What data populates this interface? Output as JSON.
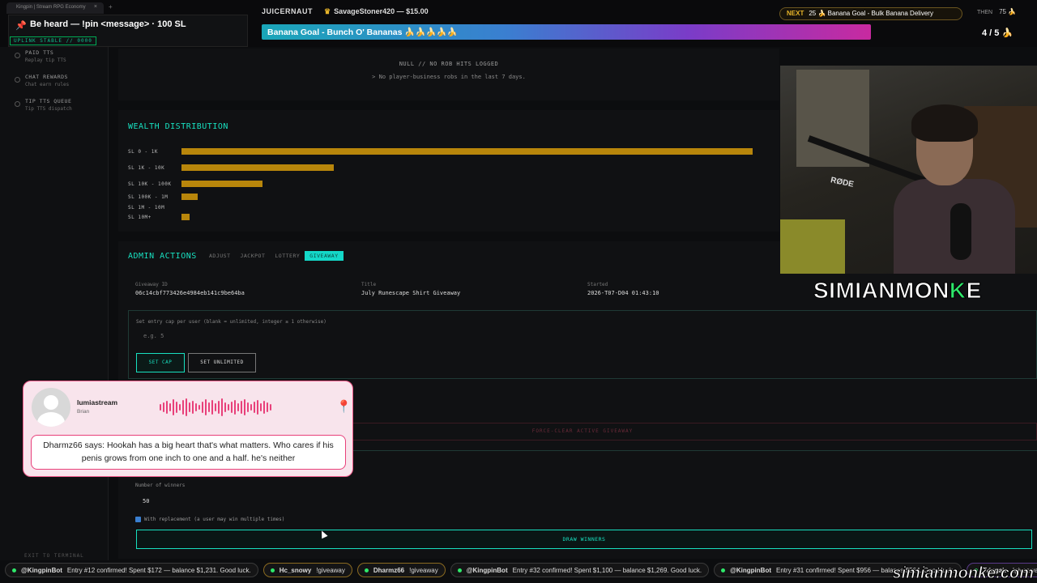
{
  "browser": {
    "tab_title": "Kingpin | Stream RPG Economy",
    "tab_close": "×",
    "new_tab": "+"
  },
  "pin_banner": {
    "text": "Be heard — !pin <message> · 100 SL",
    "status": "UPLINK STABLE // 0000"
  },
  "top_donors": {
    "brand": "JUICERNAUT",
    "top_donor": "SavageStoner420 — $15.00"
  },
  "goal": {
    "label": "Banana Goal - Bunch O' Bananas 🍌🍌🍌🍌🍌",
    "next_tag": "NEXT",
    "next_text": "25 🍌 Banana Goal - Bulk Banana Delivery",
    "then_label": "THEN",
    "then_value": "75 🍌",
    "count": "4 / 5 🍌"
  },
  "sidebar": {
    "items": [
      {
        "title": "PAID TTS",
        "sub": "Replay tip TTS"
      },
      {
        "title": "CHAT REWARDS",
        "sub": "Chat earn rules"
      },
      {
        "title": "TIP TTS QUEUE",
        "sub": "Tip TTS dispatch"
      }
    ],
    "exit": "EXIT TO TERMINAL"
  },
  "robs": {
    "title": "NULL // NO ROB HITS LOGGED",
    "sub": "> No player-business robs in the last 7 days."
  },
  "wealth": {
    "title": "WEALTH DISTRIBUTION",
    "bars": [
      {
        "label": "SL 0 - 1K",
        "fraction": 0.94
      },
      {
        "label": "SL 1K - 10K",
        "fraction": 0.25
      },
      {
        "label": "SL 10K - 100K",
        "fraction": 0.133
      },
      {
        "label": "SL 100K - 1M",
        "fraction": 0.026
      },
      {
        "label": "SL 1M - 10M",
        "fraction": 0.0
      },
      {
        "label": "SL 10M+",
        "fraction": 0.013
      }
    ]
  },
  "admin": {
    "title": "ADMIN ACTIONS",
    "tabs": [
      "ADJUST",
      "JACKPOT",
      "LOTTERY",
      "GIVEAWAY"
    ],
    "giveaway_id_label": "Giveaway ID",
    "giveaway_id": "06c14cbf773426e4984eb141c9be64ba",
    "title_label": "Title",
    "title_value": "July Runescape Shirt Giveaway",
    "started_label": "Started",
    "started_value": "2026-T07-D04 01:43:10",
    "cap_label": "Set entry cap per user (blank = unlimited, integer ≥ 1 otherwise)",
    "cap_placeholder": "e.g. 5",
    "set_cap": "SET CAP",
    "set_unlimited": "SET UNLIMITED",
    "force_clear": "FORCE-CLEAR ACTIVE GIVEAWAY",
    "winners_label": "Number of winners",
    "winners_value": "50",
    "replacement_label": "With replacement (a user may win multiple times)",
    "draw": "DRAW WINNERS"
  },
  "brand_overlay": {
    "name_a": "SIMIANMON",
    "name_b": "K",
    "name_c": "E",
    "rode": "RØDE",
    "site": "simianmonke.com"
  },
  "tts": {
    "user": "lumiastream",
    "voice": "Brian",
    "message": "Dharmz66 says: Hookah has a big heart that's what matters. Who cares if his penis grows from one inch to one and a half. he's neither"
  },
  "ticker": [
    {
      "name": "@KingpinBot",
      "text": "Entry #12 confirmed! Spent $172 — balance $1,231. Good luck."
    },
    {
      "name": "Hc_snowy",
      "text": "!giveaway"
    },
    {
      "name": "Dharmz66",
      "text": "!giveaway"
    },
    {
      "name": "@KingpinBot",
      "text": "Entry #32 confirmed! Spent $1,100 — balance $1,269. Good luck."
    },
    {
      "name": "@KingpinBot",
      "text": "Entry #31 confirmed! Spent $956 — balance $564. Good luck."
    },
    {
      "name": "Triggaja",
      "text": "!giveaway"
    }
  ],
  "colors": {
    "accent": "#18e0c0",
    "bar": "#b8860b",
    "tts_pink": "#e8407a"
  }
}
